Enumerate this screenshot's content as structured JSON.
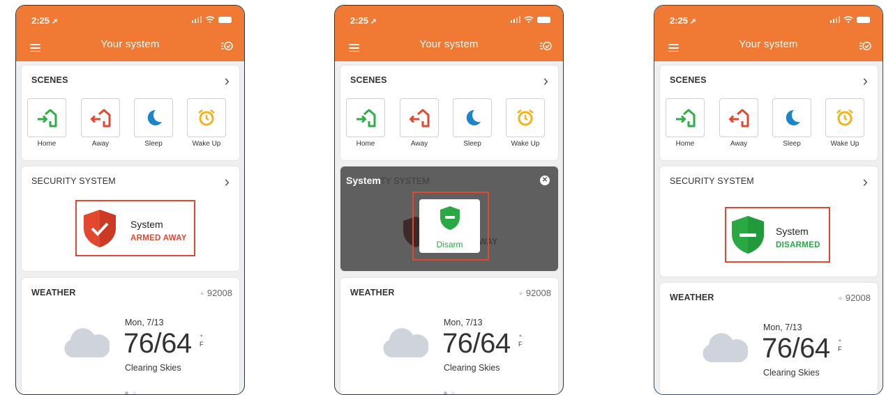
{
  "status_bar": {
    "time": "2:25",
    "time_arrow": "➚"
  },
  "header": {
    "title": "Your system"
  },
  "scenes": {
    "heading": "SCENES",
    "items": [
      {
        "label": "Home",
        "icon": "home-arrive-icon",
        "color": "#2eae4a"
      },
      {
        "label": "Away",
        "icon": "home-leave-icon",
        "color": "#e2472f"
      },
      {
        "label": "Sleep",
        "icon": "moon-icon",
        "color": "#1a86c8"
      },
      {
        "label": "Wake Up",
        "icon": "alarm-clock-icon",
        "color": "#f3b21b"
      }
    ]
  },
  "security": {
    "heading": "SECURITY SYSTEM",
    "system_label": "System",
    "armed_state": "ARMED AWAY",
    "disarmed_state": "DISARMED",
    "overlay_title": "System",
    "overlay_ghost_heading": "TY SYSTEM",
    "overlay_ghost_state": "WAY",
    "disarm_label": "Disarm",
    "close_glyph": "✕"
  },
  "weather": {
    "heading": "WEATHER",
    "zip": "92008",
    "date": "Mon, 7/13",
    "temp": "76/64",
    "unit_degree": "°",
    "unit_letter": "F",
    "condition": "Clearing Skies"
  },
  "colors": {
    "brand_orange": "#f07a33",
    "armed_red": "#e2472f",
    "disarmed_green": "#29a844"
  }
}
